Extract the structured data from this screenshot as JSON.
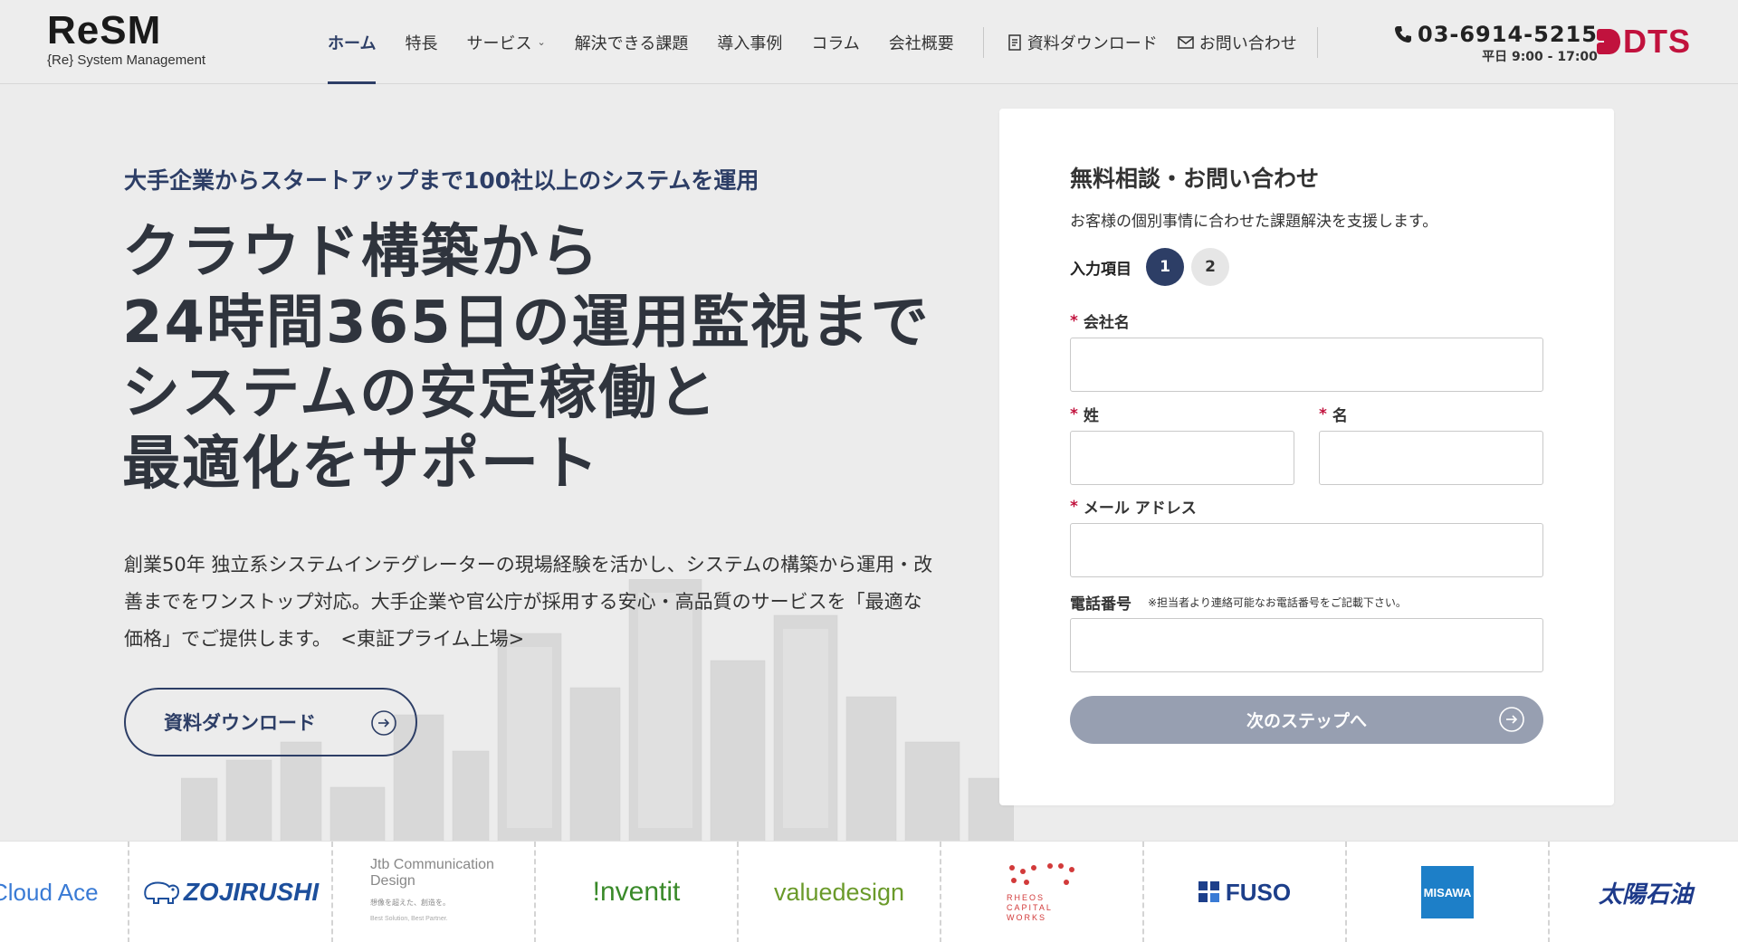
{
  "header": {
    "logo": {
      "main": "ReSM",
      "sub": "{Re} System Management"
    },
    "nav": [
      {
        "label": "ホーム",
        "active": true
      },
      {
        "label": "特長"
      },
      {
        "label": "サービス",
        "has_dropdown": true
      },
      {
        "label": "解決できる課題"
      },
      {
        "label": "導入事例"
      },
      {
        "label": "コラム"
      },
      {
        "label": "会社概要"
      }
    ],
    "utility": {
      "download": "資料ダウンロード",
      "contact": "お問い合わせ"
    },
    "phone": {
      "number": "03-6914-5215",
      "hours": "平日 9:00 - 17:00"
    },
    "brand": {
      "text": "DTS",
      "color": "#c1123d"
    }
  },
  "hero": {
    "eyebrow": "大手企業からスタートアップまで100社以上のシステムを運用",
    "headline": [
      "クラウド構築から",
      "24時間365日の運用監視まで",
      "システムの安定稼働と",
      "最適化をサポート"
    ],
    "description": "創業50年 独立系システムインテグレーターの現場経験を活かし、システムの構築から運用・改善までをワンストップ対応。大手企業や官公庁が採用する安心・高品質のサービスを「最適な価格」でご提供します。　<東証プライム上場>",
    "cta": "資料ダウンロード"
  },
  "form": {
    "title": "無料相談・お問い合わせ",
    "lead": "お客様の個別事情に合わせた課題解決を支援します。",
    "steps_label": "入力項目",
    "steps": [
      "1",
      "2"
    ],
    "current_step": "1",
    "required_mark": "*",
    "fields": {
      "company": {
        "label": "会社名",
        "value": ""
      },
      "last_name": {
        "label": "姓",
        "value": ""
      },
      "first_name": {
        "label": "名",
        "value": ""
      },
      "email": {
        "label": "メール アドレス",
        "value": ""
      },
      "phone": {
        "label": "電話番号",
        "note": "※担当者より連絡可能なお電話番号をご記載下さい。",
        "value": ""
      }
    },
    "next_button": "次のステップへ"
  },
  "clients": [
    {
      "name": "Cloud Ace",
      "color": "#3a7bd5"
    },
    {
      "name": "ZOJIRUSHI",
      "color": "#1d4f9c"
    },
    {
      "name": "Jtb Communication Design",
      "tagline": "想像を超えた、創造を。",
      "tagline2": "Best Solution, Best Partner.",
      "color": "#888888"
    },
    {
      "name": "!nventit",
      "color": "#3a8a2a"
    },
    {
      "name": "valuedesign",
      "color": "#6a9a2a"
    },
    {
      "name": "RHEOS CAPITAL WORKS",
      "color": "#d23a3a"
    },
    {
      "name": "FUSO",
      "color": "#1d3f8a"
    },
    {
      "name": "MISAWA",
      "color": "#1d7fc8"
    },
    {
      "name": "太陽石油",
      "color": "#1d3a8a"
    }
  ],
  "colors": {
    "primary": "#2d3e66",
    "accent": "#c1123d",
    "button_disabled": "#979fb1"
  }
}
